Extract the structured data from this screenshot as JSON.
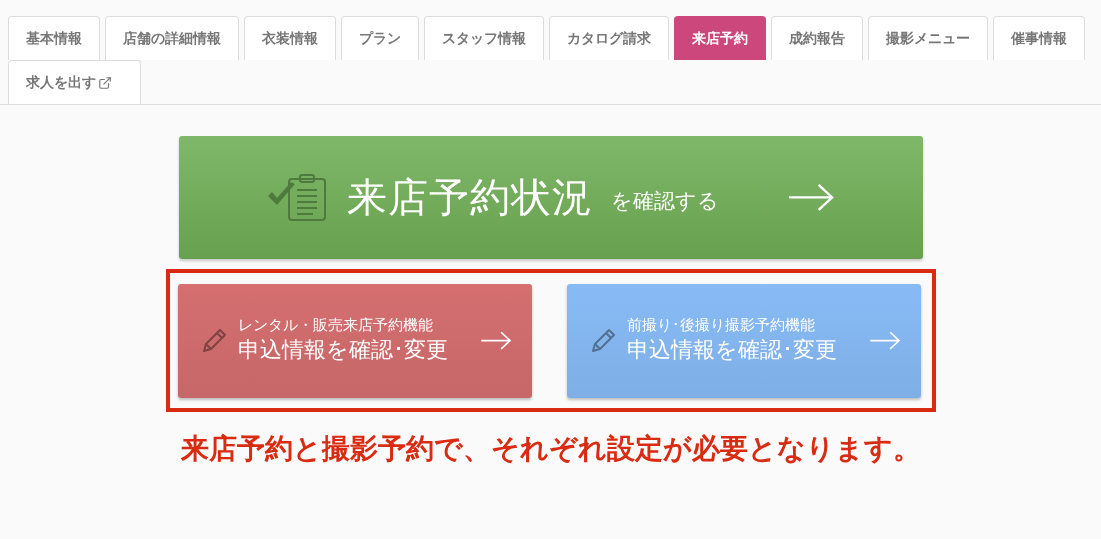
{
  "tabs": [
    {
      "label": "基本情報",
      "selected": false,
      "external": false
    },
    {
      "label": "店舗の詳細情報",
      "selected": false,
      "external": false
    },
    {
      "label": "衣装情報",
      "selected": false,
      "external": false
    },
    {
      "label": "プラン",
      "selected": false,
      "external": false
    },
    {
      "label": "スタッフ情報",
      "selected": false,
      "external": false
    },
    {
      "label": "カタログ請求",
      "selected": false,
      "external": false
    },
    {
      "label": "来店予約",
      "selected": true,
      "external": false
    },
    {
      "label": "成約報告",
      "selected": false,
      "external": false
    },
    {
      "label": "撮影メニュー",
      "selected": false,
      "external": false
    },
    {
      "label": "催事情報",
      "selected": false,
      "external": false
    },
    {
      "label": "求人を出す",
      "selected": false,
      "external": true
    }
  ],
  "status_button": {
    "title": "来店予約状況",
    "suffix": "を確認する"
  },
  "function_buttons": [
    {
      "subtitle": "レンタル・販売来店予約機能",
      "title": "申込情報を確認･変更",
      "color": "#d56f70"
    },
    {
      "subtitle": "前撮り･後撮り撮影予約機能",
      "title": "申込情報を確認･変更",
      "color": "#88bbf6"
    }
  ],
  "notice": "来店予約と撮影予約で、それぞれ設定が必要となります。"
}
